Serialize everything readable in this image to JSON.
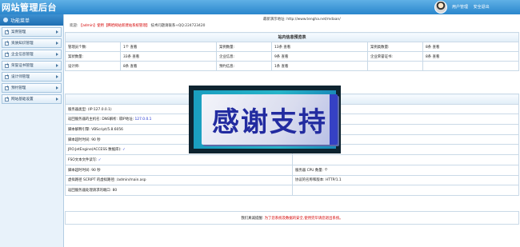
{
  "header": {
    "title": "网站管理后台",
    "links": [
      "用户管理",
      "安全退出"
    ]
  },
  "sidebar": {
    "title": "功能菜单",
    "items": [
      {
        "label": "案例管理",
        "expandable": false
      },
      {
        "label": "资质知识管理",
        "expandable": false
      },
      {
        "label": "企业信息管理",
        "expandable": true
      },
      {
        "label": "荣誉证书管理",
        "expandable": true
      },
      {
        "label": "设计师管理",
        "expandable": true
      },
      {
        "label": "预约管理",
        "expandable": true
      },
      {
        "label": "网站基础设置",
        "expandable": true
      }
    ]
  },
  "info_bar": {
    "demo_url": "最新演示地址: http://www.tengha.net/mdaan/",
    "announce_prefix": "欢迎:",
    "announce_red": "【admin】使用【腾哈网站新建站系统管理】",
    "announce_suffix": "技术问题请联系+QQ:224723420"
  },
  "stats": {
    "title": "站内信息预览表",
    "rows": [
      [
        {
          "label": "管理员个数:",
          "value": "1个 查看"
        },
        {
          "label": "案例数量:",
          "value": "13条 查看"
        },
        {
          "label": "案例类数量:",
          "value": "8条 查看"
        }
      ],
      [
        {
          "label": "案状数量:",
          "value": "33条 查看"
        },
        {
          "label": "企业信息:",
          "value": "9条 查看"
        },
        {
          "label": "企业荣誉证书:",
          "value": "8条 查看"
        }
      ],
      [
        {
          "label": "设计师:",
          "value": "8条 查看"
        },
        {
          "label": "预约信息:",
          "value": "1条 查看"
        },
        {
          "label": "",
          "value": ""
        }
      ]
    ]
  },
  "server": {
    "title": "服务器信息",
    "rows": [
      {
        "left": "服务器类型: (IP:127.0.0.1)",
        "right": ""
      },
      {
        "left_label": "返回服务器的主机名: DNS解析: 或IP地址: ",
        "left_blue": "127.0.0.1",
        "right": ""
      },
      {
        "left": "脚本解释引擎: VBScript/5.8.6056",
        "right_label": "",
        "right_blue": "Microsoft-IIS/8.0"
      },
      {
        "left": "脚本超时时间: 90 秒",
        "right": ""
      },
      {
        "left_label": "JRO.JetEngine(ACCESS 数据库): ",
        "left_check": "✓",
        "right": ""
      },
      {
        "left_label": "FSO文本文件读写: ",
        "left_check": "✓",
        "right": ""
      },
      {
        "left": "脚本超时时间: 90 秒",
        "right": "服务器 CPU 数量: 个"
      },
      {
        "left": "虚拟路径 SCRIPT 的虚拟路径: /admin/main.asp",
        "right": "协议的名称和版本: HTTP/1.1"
      },
      {
        "left": "返回服务器处理请求的端口: 80",
        "right": ""
      }
    ]
  },
  "notice": {
    "label": "我们真诚提醒:",
    "text": "为了您系统及数据的安全,使用完毕请您退出系统。"
  },
  "overlay": {
    "text": "感谢支持"
  }
}
